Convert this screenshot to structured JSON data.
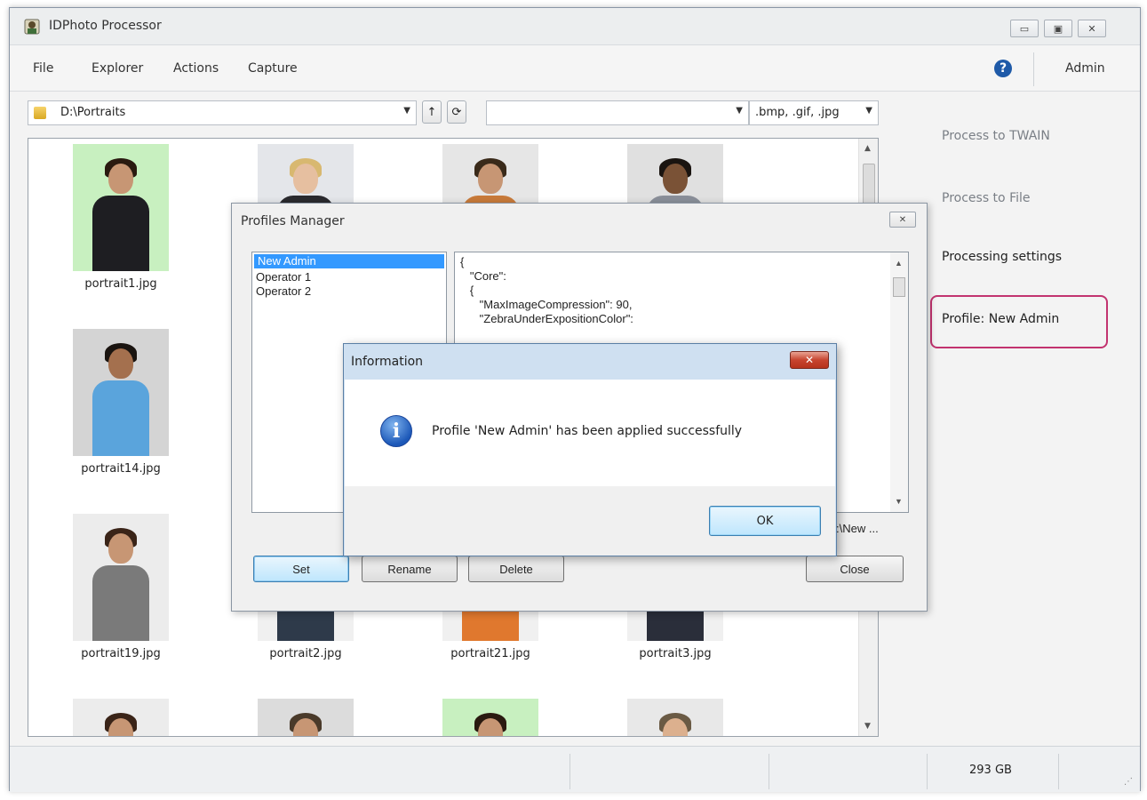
{
  "window": {
    "title": "IDPhoto Processor",
    "controls": {
      "minimize": "▭",
      "maximize": "▣",
      "close": "✕"
    }
  },
  "menu": {
    "items": [
      "File",
      "Explorer",
      "Actions",
      "Capture"
    ],
    "help_icon": "?",
    "user": "Admin"
  },
  "toolbar": {
    "path": "D:\\Portraits",
    "up_icon": "↑",
    "refresh_icon": "⟳",
    "filter": "",
    "extensions": ".bmp, .gif, .jpg"
  },
  "files": [
    {
      "name": "portrait1.jpg"
    },
    {
      "name": "portrait14.jpg"
    },
    {
      "name": "portrait19.jpg"
    },
    {
      "name": "portrait2.jpg"
    },
    {
      "name": "portrait21.jpg"
    },
    {
      "name": "portrait3.jpg"
    }
  ],
  "right_panel": {
    "process_twain": "Process to TWAIN",
    "process_file": "Process to File",
    "processing_settings": "Processing settings",
    "profile": "Profile: New Admin"
  },
  "statusbar": {
    "disk": "293 GB"
  },
  "profiles_manager": {
    "title": "Profiles Manager",
    "close_icon": "✕",
    "profiles": [
      "New Admin",
      "Operator 1",
      "Operator 2"
    ],
    "selected": "New Admin",
    "json_text": "{\n   \"Core\":\n   {\n      \"MaxImageCompression\": 90,\n      \"ZebraUnderExpositionColor\":",
    "path_fragment": ":\\New ...",
    "buttons": {
      "set": "Set",
      "rename": "Rename",
      "delete": "Delete",
      "close": "Close"
    }
  },
  "info_dialog": {
    "title": "Information",
    "close_icon": "✕",
    "icon": "i",
    "message": "Profile 'New Admin' has been applied successfully",
    "ok": "OK"
  },
  "colors": {
    "highlight_border": "#c2336f",
    "selection": "#3399ff"
  }
}
